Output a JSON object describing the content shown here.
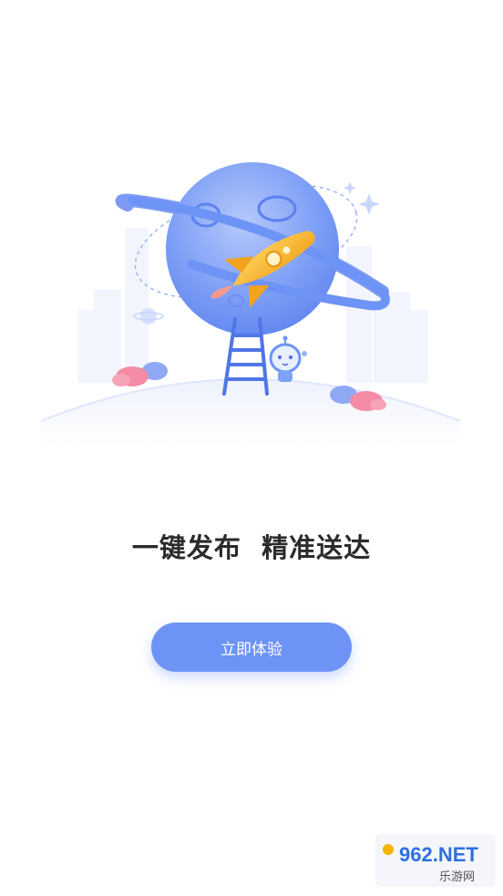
{
  "page": {
    "slogan": "一键发布  精准送达",
    "cta_label": "立即体验"
  },
  "colors": {
    "accent": "#6e93f6",
    "planet": "#7ea1f7",
    "rocket": "#f7b52c",
    "cloud_pink": "#f48ca5",
    "text": "#2b2b2b"
  },
  "watermark": {
    "brand_number": "962.NET",
    "brand_cn": "乐游网"
  }
}
